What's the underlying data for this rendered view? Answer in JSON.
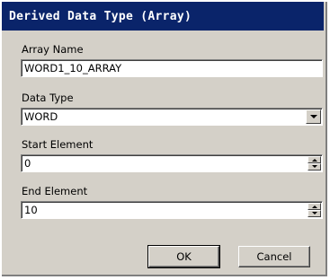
{
  "dialog": {
    "title": "Derived Data Type (Array)"
  },
  "fields": {
    "array_name": {
      "label": "Array Name",
      "value": "WORD1_10_ARRAY"
    },
    "data_type": {
      "label": "Data Type",
      "value": "WORD"
    },
    "start_element": {
      "label": "Start Element",
      "value": "0"
    },
    "end_element": {
      "label": "End Element",
      "value": "10"
    }
  },
  "buttons": {
    "ok": "OK",
    "cancel": "Cancel"
  },
  "icons": {
    "dropdown": "chevron-down-icon",
    "spin_up": "spin-up-icon",
    "spin_down": "spin-down-icon"
  },
  "colors": {
    "titlebar": "#0a246a",
    "dialog_bg": "#d4d0c8"
  }
}
